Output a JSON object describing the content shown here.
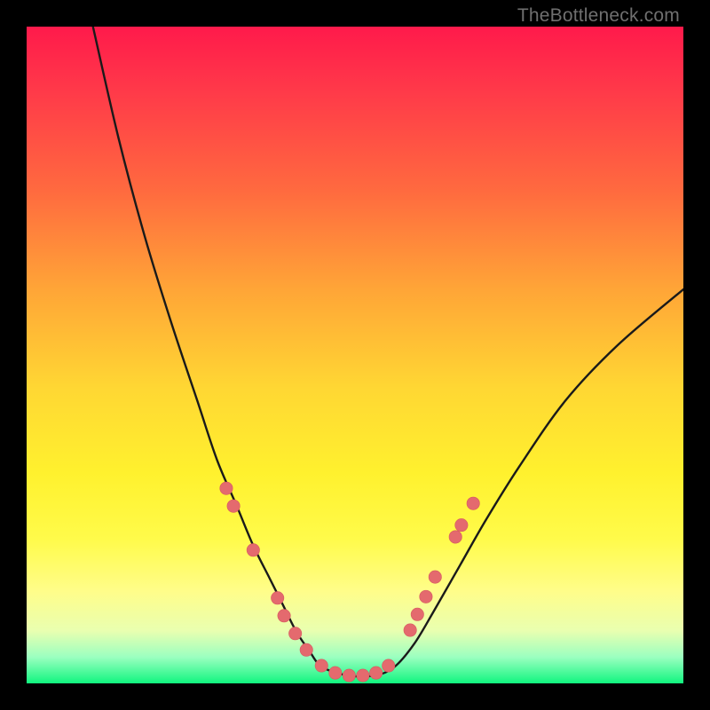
{
  "watermark": {
    "text": "TheBottleneck.com"
  },
  "colors": {
    "curve_stroke": "#1a1a1a",
    "marker_fill": "#e46a6e",
    "marker_stroke": "#d65a60"
  },
  "chart_data": {
    "type": "line",
    "title": "",
    "xlabel": "",
    "ylabel": "",
    "xlim": [
      0,
      100
    ],
    "ylim": [
      0,
      100
    ],
    "grid": false,
    "legend": false,
    "series": [
      {
        "name": "curve",
        "x": [
          10.1,
          14,
          18,
          22,
          26,
          29,
          32,
          34.5,
          37,
          39,
          41,
          43,
          45,
          49,
          53,
          56,
          59,
          62,
          66,
          70,
          75,
          82,
          90,
          100
        ],
        "y": [
          100,
          83,
          68,
          55,
          43,
          34,
          27,
          21,
          16,
          12,
          8,
          5,
          2.5,
          1.2,
          1.2,
          2.5,
          6,
          11,
          18,
          25,
          33,
          43,
          51.5,
          60
        ]
      }
    ],
    "markers": [
      {
        "x": 30.4,
        "y": 29.7
      },
      {
        "x": 31.5,
        "y": 27.0
      },
      {
        "x": 34.5,
        "y": 20.3
      },
      {
        "x": 38.2,
        "y": 13.0
      },
      {
        "x": 39.2,
        "y": 10.3
      },
      {
        "x": 40.9,
        "y": 7.6
      },
      {
        "x": 42.6,
        "y": 5.1
      },
      {
        "x": 44.9,
        "y": 2.7
      },
      {
        "x": 47.0,
        "y": 1.6
      },
      {
        "x": 49.1,
        "y": 1.2
      },
      {
        "x": 51.2,
        "y": 1.2
      },
      {
        "x": 53.2,
        "y": 1.6
      },
      {
        "x": 55.1,
        "y": 2.7
      },
      {
        "x": 58.4,
        "y": 8.1
      },
      {
        "x": 59.5,
        "y": 10.5
      },
      {
        "x": 60.8,
        "y": 13.2
      },
      {
        "x": 62.2,
        "y": 16.2
      },
      {
        "x": 65.3,
        "y": 22.3
      },
      {
        "x": 66.2,
        "y": 24.1
      },
      {
        "x": 68.0,
        "y": 27.4
      }
    ]
  }
}
